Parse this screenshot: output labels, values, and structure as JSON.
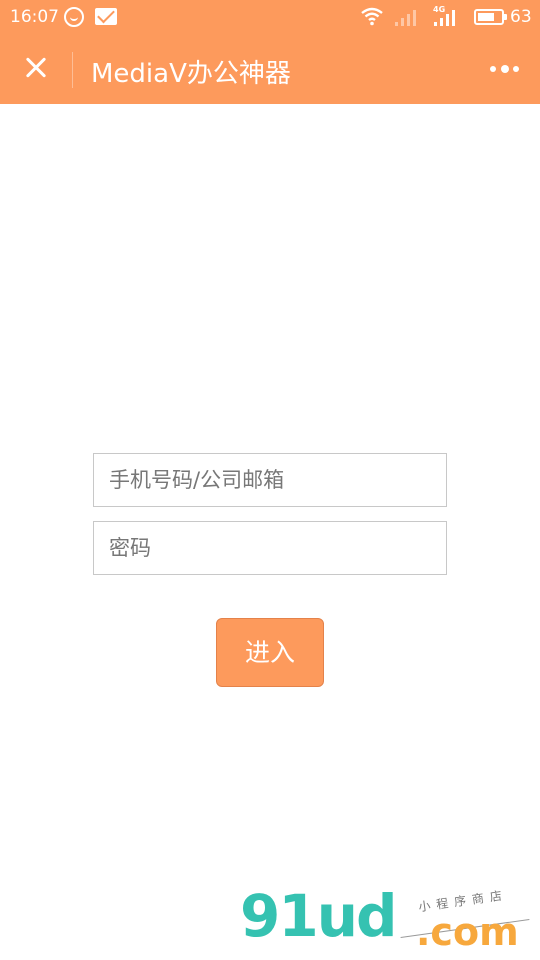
{
  "status_bar": {
    "time": "16:07",
    "battery_level": "63",
    "network_tag": "4G"
  },
  "nav": {
    "title": "MediaV办公神器",
    "close_icon": "close-icon",
    "more_icon": "more-dots-icon"
  },
  "form": {
    "account_placeholder": "手机号码/公司邮箱",
    "account_value": "",
    "password_placeholder": "密码",
    "password_value": "",
    "submit_label": "进入"
  },
  "watermark": {
    "brand": "91ud",
    "domain": ".com",
    "tagline": "小程序商店"
  },
  "colors": {
    "accent": "#fd9a5c",
    "watermark_teal": "#35c2b1",
    "watermark_orange": "#f7a83d"
  }
}
